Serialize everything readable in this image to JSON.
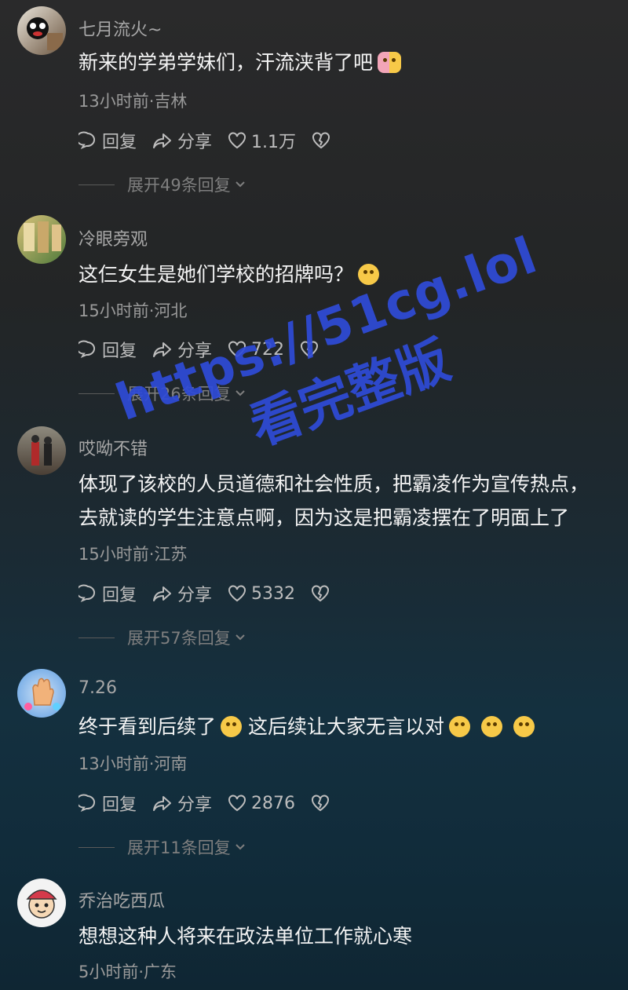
{
  "comments": [
    {
      "user": "七月流火~",
      "text": "新来的学弟学妹们，汗流浃背了吧",
      "emoji": "couple-emoji",
      "meta": "13小时前·吉林",
      "reply_label": "回复",
      "share_label": "分享",
      "likes": "1.1万",
      "replies": "展开49条回复"
    },
    {
      "user": "冷眼旁观",
      "text": "这仨女生是她们学校的招牌吗？",
      "emoji": "laughing-emoji",
      "meta": "15小时前·河北",
      "reply_label": "回复",
      "share_label": "分享",
      "likes": "722",
      "replies": "展开26条回复"
    },
    {
      "user": "哎呦不错",
      "text": "体现了该校的人员道德和社会性质，把霸凌作为宣传热点，去就读的学生注意点啊，因为这是把霸凌摆在了明面上了",
      "meta": "15小时前·江苏",
      "reply_label": "回复",
      "share_label": "分享",
      "likes": "5332",
      "replies": "展开57条回复"
    },
    {
      "user": "7.26",
      "text_a": "终于看到后续了",
      "text_b": "这后续让大家无言以对",
      "emoji": "sweat-emoji",
      "meta": "13小时前·河南",
      "reply_label": "回复",
      "share_label": "分享",
      "likes": "2876",
      "replies": "展开11条回复"
    },
    {
      "user": "乔治吃西瓜",
      "text": "想想这种人将来在政法单位工作就心寒",
      "meta": "5小时前·广东"
    }
  ],
  "watermark": {
    "line1": "https://51cg.lol",
    "line2": "看完整版"
  },
  "colors": {
    "watermark": "#2f4bd8",
    "text": "#f4f4f4",
    "meta": "#9a9a9a"
  }
}
